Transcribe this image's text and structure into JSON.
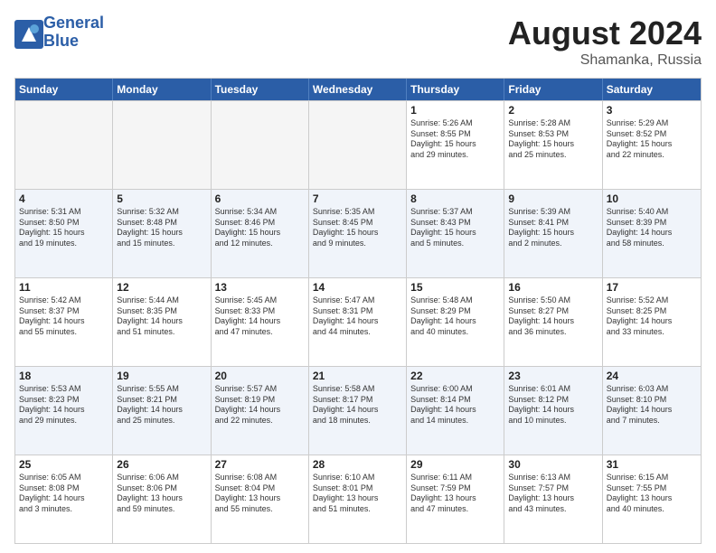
{
  "logo": {
    "line1": "General",
    "line2": "Blue"
  },
  "title": {
    "month_year": "August 2024",
    "location": "Shamanka, Russia"
  },
  "days_of_week": [
    "Sunday",
    "Monday",
    "Tuesday",
    "Wednesday",
    "Thursday",
    "Friday",
    "Saturday"
  ],
  "weeks": [
    [
      {
        "day": "",
        "empty": true,
        "lines": []
      },
      {
        "day": "",
        "empty": true,
        "lines": []
      },
      {
        "day": "",
        "empty": true,
        "lines": []
      },
      {
        "day": "",
        "empty": true,
        "lines": []
      },
      {
        "day": "1",
        "empty": false,
        "lines": [
          "Sunrise: 5:26 AM",
          "Sunset: 8:55 PM",
          "Daylight: 15 hours",
          "and 29 minutes."
        ]
      },
      {
        "day": "2",
        "empty": false,
        "lines": [
          "Sunrise: 5:28 AM",
          "Sunset: 8:53 PM",
          "Daylight: 15 hours",
          "and 25 minutes."
        ]
      },
      {
        "day": "3",
        "empty": false,
        "lines": [
          "Sunrise: 5:29 AM",
          "Sunset: 8:52 PM",
          "Daylight: 15 hours",
          "and 22 minutes."
        ]
      }
    ],
    [
      {
        "day": "4",
        "empty": false,
        "lines": [
          "Sunrise: 5:31 AM",
          "Sunset: 8:50 PM",
          "Daylight: 15 hours",
          "and 19 minutes."
        ]
      },
      {
        "day": "5",
        "empty": false,
        "lines": [
          "Sunrise: 5:32 AM",
          "Sunset: 8:48 PM",
          "Daylight: 15 hours",
          "and 15 minutes."
        ]
      },
      {
        "day": "6",
        "empty": false,
        "lines": [
          "Sunrise: 5:34 AM",
          "Sunset: 8:46 PM",
          "Daylight: 15 hours",
          "and 12 minutes."
        ]
      },
      {
        "day": "7",
        "empty": false,
        "lines": [
          "Sunrise: 5:35 AM",
          "Sunset: 8:45 PM",
          "Daylight: 15 hours",
          "and 9 minutes."
        ]
      },
      {
        "day": "8",
        "empty": false,
        "lines": [
          "Sunrise: 5:37 AM",
          "Sunset: 8:43 PM",
          "Daylight: 15 hours",
          "and 5 minutes."
        ]
      },
      {
        "day": "9",
        "empty": false,
        "lines": [
          "Sunrise: 5:39 AM",
          "Sunset: 8:41 PM",
          "Daylight: 15 hours",
          "and 2 minutes."
        ]
      },
      {
        "day": "10",
        "empty": false,
        "lines": [
          "Sunrise: 5:40 AM",
          "Sunset: 8:39 PM",
          "Daylight: 14 hours",
          "and 58 minutes."
        ]
      }
    ],
    [
      {
        "day": "11",
        "empty": false,
        "lines": [
          "Sunrise: 5:42 AM",
          "Sunset: 8:37 PM",
          "Daylight: 14 hours",
          "and 55 minutes."
        ]
      },
      {
        "day": "12",
        "empty": false,
        "lines": [
          "Sunrise: 5:44 AM",
          "Sunset: 8:35 PM",
          "Daylight: 14 hours",
          "and 51 minutes."
        ]
      },
      {
        "day": "13",
        "empty": false,
        "lines": [
          "Sunrise: 5:45 AM",
          "Sunset: 8:33 PM",
          "Daylight: 14 hours",
          "and 47 minutes."
        ]
      },
      {
        "day": "14",
        "empty": false,
        "lines": [
          "Sunrise: 5:47 AM",
          "Sunset: 8:31 PM",
          "Daylight: 14 hours",
          "and 44 minutes."
        ]
      },
      {
        "day": "15",
        "empty": false,
        "lines": [
          "Sunrise: 5:48 AM",
          "Sunset: 8:29 PM",
          "Daylight: 14 hours",
          "and 40 minutes."
        ]
      },
      {
        "day": "16",
        "empty": false,
        "lines": [
          "Sunrise: 5:50 AM",
          "Sunset: 8:27 PM",
          "Daylight: 14 hours",
          "and 36 minutes."
        ]
      },
      {
        "day": "17",
        "empty": false,
        "lines": [
          "Sunrise: 5:52 AM",
          "Sunset: 8:25 PM",
          "Daylight: 14 hours",
          "and 33 minutes."
        ]
      }
    ],
    [
      {
        "day": "18",
        "empty": false,
        "lines": [
          "Sunrise: 5:53 AM",
          "Sunset: 8:23 PM",
          "Daylight: 14 hours",
          "and 29 minutes."
        ]
      },
      {
        "day": "19",
        "empty": false,
        "lines": [
          "Sunrise: 5:55 AM",
          "Sunset: 8:21 PM",
          "Daylight: 14 hours",
          "and 25 minutes."
        ]
      },
      {
        "day": "20",
        "empty": false,
        "lines": [
          "Sunrise: 5:57 AM",
          "Sunset: 8:19 PM",
          "Daylight: 14 hours",
          "and 22 minutes."
        ]
      },
      {
        "day": "21",
        "empty": false,
        "lines": [
          "Sunrise: 5:58 AM",
          "Sunset: 8:17 PM",
          "Daylight: 14 hours",
          "and 18 minutes."
        ]
      },
      {
        "day": "22",
        "empty": false,
        "lines": [
          "Sunrise: 6:00 AM",
          "Sunset: 8:14 PM",
          "Daylight: 14 hours",
          "and 14 minutes."
        ]
      },
      {
        "day": "23",
        "empty": false,
        "lines": [
          "Sunrise: 6:01 AM",
          "Sunset: 8:12 PM",
          "Daylight: 14 hours",
          "and 10 minutes."
        ]
      },
      {
        "day": "24",
        "empty": false,
        "lines": [
          "Sunrise: 6:03 AM",
          "Sunset: 8:10 PM",
          "Daylight: 14 hours",
          "and 7 minutes."
        ]
      }
    ],
    [
      {
        "day": "25",
        "empty": false,
        "lines": [
          "Sunrise: 6:05 AM",
          "Sunset: 8:08 PM",
          "Daylight: 14 hours",
          "and 3 minutes."
        ]
      },
      {
        "day": "26",
        "empty": false,
        "lines": [
          "Sunrise: 6:06 AM",
          "Sunset: 8:06 PM",
          "Daylight: 13 hours",
          "and 59 minutes."
        ]
      },
      {
        "day": "27",
        "empty": false,
        "lines": [
          "Sunrise: 6:08 AM",
          "Sunset: 8:04 PM",
          "Daylight: 13 hours",
          "and 55 minutes."
        ]
      },
      {
        "day": "28",
        "empty": false,
        "lines": [
          "Sunrise: 6:10 AM",
          "Sunset: 8:01 PM",
          "Daylight: 13 hours",
          "and 51 minutes."
        ]
      },
      {
        "day": "29",
        "empty": false,
        "lines": [
          "Sunrise: 6:11 AM",
          "Sunset: 7:59 PM",
          "Daylight: 13 hours",
          "and 47 minutes."
        ]
      },
      {
        "day": "30",
        "empty": false,
        "lines": [
          "Sunrise: 6:13 AM",
          "Sunset: 7:57 PM",
          "Daylight: 13 hours",
          "and 43 minutes."
        ]
      },
      {
        "day": "31",
        "empty": false,
        "lines": [
          "Sunrise: 6:15 AM",
          "Sunset: 7:55 PM",
          "Daylight: 13 hours",
          "and 40 minutes."
        ]
      }
    ]
  ]
}
